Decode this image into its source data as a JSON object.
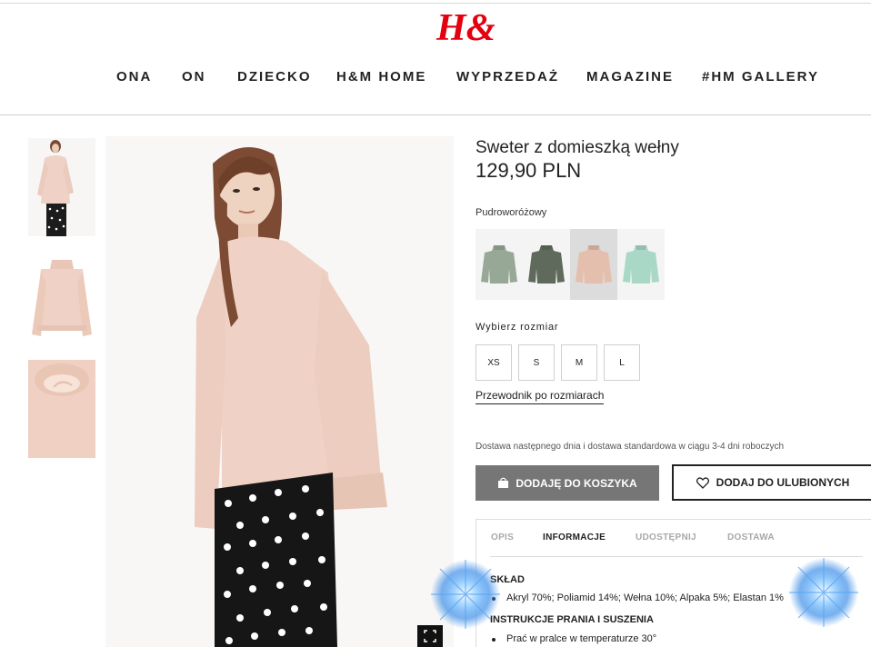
{
  "header": {
    "logo_text": "H&M",
    "nav": [
      "ONA",
      "ON",
      "DZIECKO",
      "H&M HOME",
      "WYPRZEDAŻ",
      "MAGAZINE",
      "#HM GALLERY"
    ]
  },
  "product": {
    "title": "Sweter z domieszką wełny",
    "price": "129,90 PLN",
    "selected_color_name": "Pudroworóżowy",
    "color_swatches": [
      "#98a897",
      "#5f6a5c",
      "#e4bfae",
      "#a9d8c7"
    ],
    "selected_swatch_index": 2,
    "size_label": "Wybierz rozmiar",
    "sizes": [
      "XS",
      "S",
      "M",
      "L"
    ],
    "size_guide": "Przewodnik po rozmiarach",
    "delivery": "Dostawa następnego dnia i dostawa standardowa w ciągu 3-4 dni roboczych",
    "add_to_bag": "DODAJĘ DO KOSZYKA",
    "add_to_favorites": "DODAJ DO ULUBIONYCH"
  },
  "info": {
    "tabs": [
      "OPIS",
      "INFORMACJE",
      "UDOSTĘPNIJ",
      "DOSTAWA"
    ],
    "active_tab": "INFORMACJE",
    "composition_title": "SKŁAD",
    "composition_items": [
      "Akryl 70%; Poliamid 14%; Wełna 10%; Alpaka 5%; Elastan 1%"
    ],
    "care_title": "INSTRUKCJE PRANIA I SUSZENIA",
    "care_items": [
      "Prać w pralce w temperaturze 30°"
    ]
  },
  "icons": {
    "bag": "shopping-bag-icon",
    "heart": "heart-icon",
    "fullscreen": "fullscreen-icon"
  },
  "colors": {
    "brand_red": "#e50010",
    "add_to_bag_bg": "#767676",
    "sweater": "#efd2c5"
  }
}
